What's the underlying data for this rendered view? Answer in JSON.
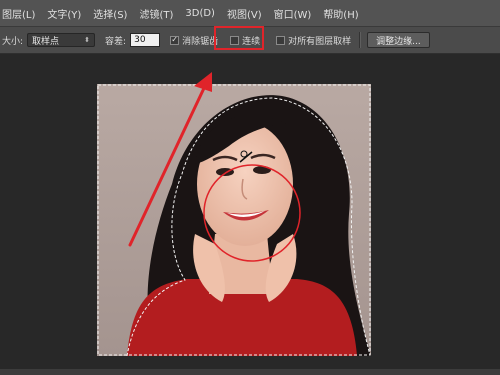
{
  "menubar": {
    "items": [
      "图层(L)",
      "文字(Y)",
      "选择(S)",
      "滤镜(T)",
      "3D(D)",
      "视图(V)",
      "窗口(W)",
      "帮助(H)"
    ]
  },
  "options": {
    "size_label": "大小:",
    "size_value": "取样点",
    "tolerance_label": "容差:",
    "tolerance_value": "30",
    "antialias_checked": true,
    "antialias_label": "消除锯齿",
    "contiguous_checked": false,
    "contiguous_label": "连续",
    "all_layers_checked": false,
    "all_layers_label": "对所有图层取样",
    "refine_edge_label": "调整边缘..."
  },
  "colors": {
    "annotation": "#e0242a",
    "menubar": "#535353",
    "optionsbar": "#4b4b4b",
    "workspace": "#282828"
  },
  "icons": {
    "checkmark": "check-icon",
    "dropdown": "chevron-down-icon",
    "wand_cursor": "magic-wand-cursor-icon",
    "arrow": "annotation-arrow-icon"
  }
}
